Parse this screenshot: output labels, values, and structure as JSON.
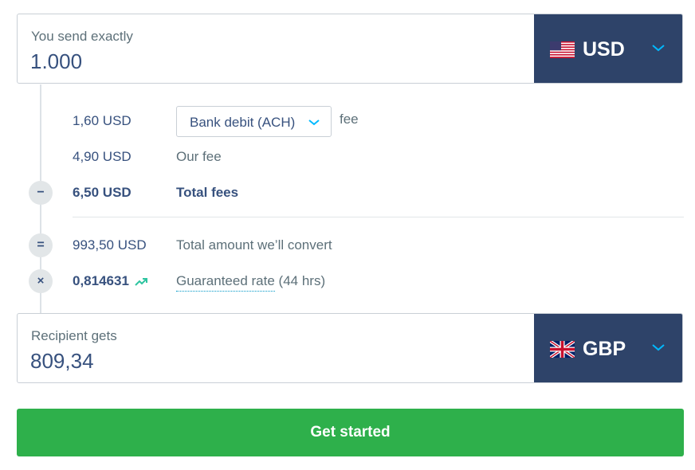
{
  "send": {
    "label": "You send exactly",
    "value": "1.000",
    "currency": "USD",
    "flag_icon": "us-flag-icon"
  },
  "fees": {
    "method_fee_amount": "1,60 USD",
    "method_selected": "Bank debit (ACH)",
    "method_fee_suffix": "fee",
    "our_fee_amount": "4,90 USD",
    "our_fee_label": "Our fee",
    "total_fees_amount": "6,50 USD",
    "total_fees_label": "Total fees",
    "minus_symbol": "−"
  },
  "convert": {
    "equals_symbol": "=",
    "amount": "993,50 USD",
    "label": "Total amount we’ll convert"
  },
  "rate": {
    "times_symbol": "×",
    "value": "0,814631",
    "trend_icon": "trending-up-icon",
    "link_text": "Guaranteed rate",
    "duration": "(44 hrs)"
  },
  "receive": {
    "label": "Recipient gets",
    "value": "809,34",
    "currency": "GBP",
    "flag_icon": "uk-flag-icon"
  },
  "cta": {
    "label": "Get started"
  },
  "colors": {
    "navy": "#2e4369",
    "text": "#37517e",
    "muted": "#5d7079",
    "accent": "#0097c7",
    "green": "#2eb04b"
  }
}
